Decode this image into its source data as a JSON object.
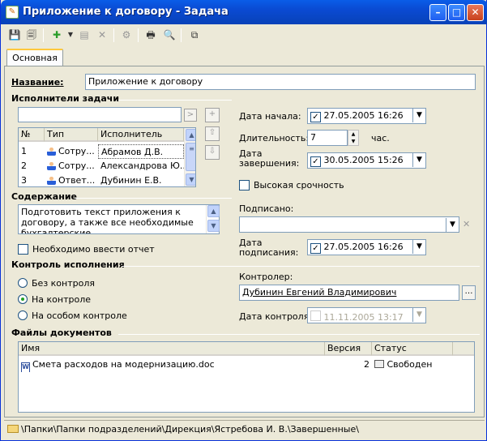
{
  "window": {
    "title": "Приложение к договору - Задача"
  },
  "tabs": [
    {
      "label": "Основная"
    }
  ],
  "name": {
    "label": "Название:",
    "value": "Приложение к договору"
  },
  "executors": {
    "section": "Исполнители задачи",
    "columns": [
      "№",
      "Тип",
      "Исполнитель"
    ],
    "rows": [
      {
        "n": "1",
        "type": "Сотру...",
        "name": "Абрамов Д.В."
      },
      {
        "n": "2",
        "type": "Сотру...",
        "name": "Александрова Ю...."
      },
      {
        "n": "3",
        "type": "Ответ...",
        "name": "Дубинин Е.В."
      }
    ]
  },
  "start": {
    "label": "Дата начала:",
    "value": "27.05.2005 16:26"
  },
  "duration": {
    "label": "Длительность:",
    "value": "7",
    "unit": "час."
  },
  "end": {
    "label": "Дата завершения:",
    "label1": "Дата",
    "label2": "завершения:",
    "value": "30.05.2005 15:26"
  },
  "urgent": {
    "label": "Высокая срочность"
  },
  "content": {
    "section": "Содержание",
    "text": "Подготовить текст приложения к договору, а также все необходимые бухгалтерские"
  },
  "report": {
    "label": "Необходимо ввести отчет"
  },
  "signed": {
    "label": "Подписано:",
    "value": ""
  },
  "signdate": {
    "label1": "Дата",
    "label2": "подписания:",
    "value": "27.05.2005 16:26"
  },
  "control": {
    "section": "Контроль исполнения",
    "options": [
      "Без контроля",
      "На контроле",
      "На особом контроле"
    ],
    "selected": 1
  },
  "controller": {
    "label": "Контролер:",
    "value": "Дубинин Евгений Владимирович"
  },
  "controldate": {
    "label": "Дата контроля:",
    "value": "11.11.2005 13:17"
  },
  "files": {
    "section": "Файлы документов",
    "columns": [
      "Имя",
      "Версия",
      "Статус"
    ],
    "rows": [
      {
        "name": "Смета расходов на модернизацию.doc",
        "version": "2",
        "status": "Свободен"
      }
    ]
  },
  "status": {
    "path": "\\Папки\\Папки подразделений\\Дирекция\\Ястребова И. В.\\Завершенные\\"
  }
}
